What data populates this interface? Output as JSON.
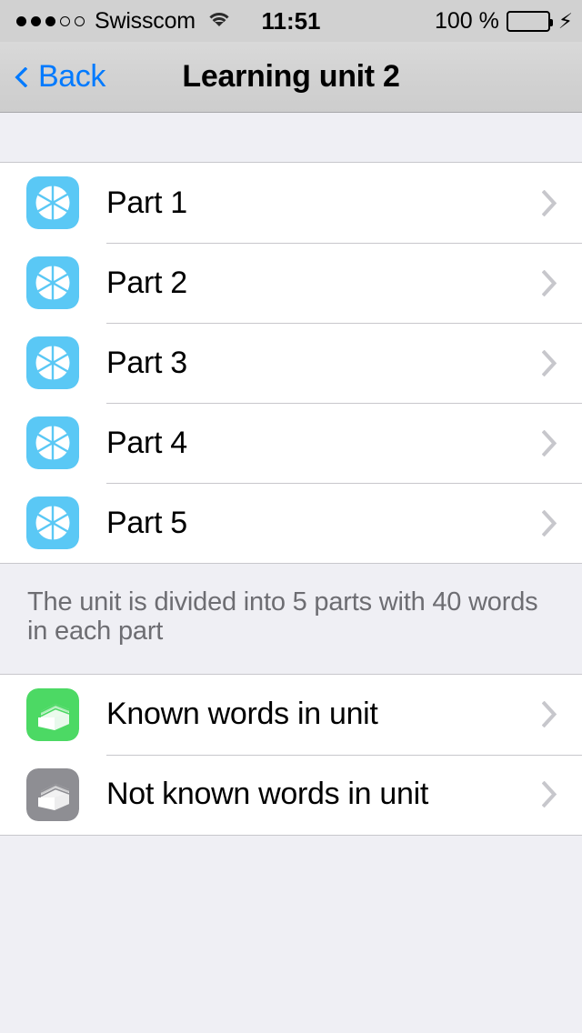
{
  "status_bar": {
    "signal_dots_filled": 3,
    "signal_dots_total": 5,
    "carrier": "Swisscom",
    "wifi_icon": "wifi-icon",
    "time": "11:51",
    "battery_percent": "100 %",
    "battery_level": 100,
    "battery_color": "#4CD964",
    "charging_icon": "lightning-bolt-icon",
    "background_color": "#D1D1D1"
  },
  "nav_bar": {
    "back_icon": "chevron-left-icon",
    "back_label": "Back",
    "title": "Learning unit 2",
    "tint_color": "#007AFF"
  },
  "sections": [
    {
      "name": "parts-section",
      "rows": [
        {
          "label": "Part 1",
          "icon": "pie-segments-icon",
          "icon_color": "#5AC8F5",
          "accessory": "chevron-right-icon"
        },
        {
          "label": "Part 2",
          "icon": "pie-segments-icon",
          "icon_color": "#5AC8F5",
          "accessory": "chevron-right-icon"
        },
        {
          "label": "Part 3",
          "icon": "pie-segments-icon",
          "icon_color": "#5AC8F5",
          "accessory": "chevron-right-icon"
        },
        {
          "label": "Part 4",
          "icon": "pie-segments-icon",
          "icon_color": "#5AC8F5",
          "accessory": "chevron-right-icon"
        },
        {
          "label": "Part 5",
          "icon": "pie-segments-icon",
          "icon_color": "#5AC8F5",
          "accessory": "chevron-right-icon"
        }
      ],
      "footer": "The unit is divided into 5 parts with 40 words in each part"
    },
    {
      "name": "word-lists-section",
      "rows": [
        {
          "label": "Known words in unit",
          "icon": "card-box-icon",
          "icon_color": "#4CD964",
          "accessory": "chevron-right-icon"
        },
        {
          "label": "Not known words in unit",
          "icon": "card-box-icon",
          "icon_color": "#8E8E93",
          "accessory": "chevron-right-icon"
        }
      ]
    }
  ],
  "colors": {
    "background": "#EFEFF4",
    "separator": "#C8C7CC",
    "chevron": "#C7C7CC",
    "footer_text": "#6D6D72"
  }
}
